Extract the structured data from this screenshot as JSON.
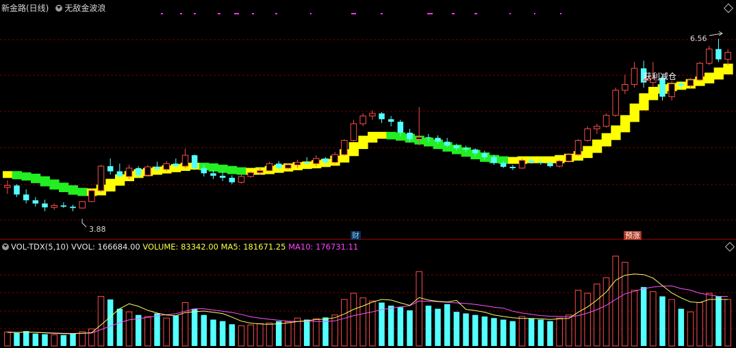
{
  "header": {
    "title": "新金路(日线)",
    "indicator": "无敌金波浪",
    "sell_signal": "获利减仓",
    "tag_cai": "财",
    "tag_yuzhang": "预涨",
    "high_label": "6.56",
    "low_label": "3.88"
  },
  "volume_header": {
    "name": "VOL-TDX(5,10)",
    "vvol": "VVOL: 166684.00",
    "volume": "VOLUME: 83342.00",
    "ma5": "MA5: 181671.25",
    "ma10": "MA10: 176731.11"
  },
  "colors": {
    "up": "#ff4d4d",
    "down": "#54ffff",
    "wave_up": "#ffff00",
    "wave_down": "#22ee22",
    "ma5": "#ffff66",
    "ma10": "#ff55ff",
    "grid": "#7a0000",
    "dots": "#ff33ff"
  },
  "chart_data": {
    "type": "candlestick",
    "ylim": [
      3.55,
      6.95
    ],
    "candles": [
      [
        4.25,
        4.36,
        4.15,
        4.28
      ],
      [
        4.28,
        4.3,
        4.1,
        4.14
      ],
      [
        4.14,
        4.22,
        4.0,
        4.05
      ],
      [
        4.05,
        4.1,
        3.95,
        4.0
      ],
      [
        4.0,
        4.06,
        3.88,
        3.94
      ],
      [
        3.94,
        4.0,
        3.9,
        3.97
      ],
      [
        3.97,
        4.02,
        3.93,
        3.95
      ],
      [
        3.95,
        3.98,
        3.88,
        3.93
      ],
      [
        3.93,
        4.04,
        3.92,
        4.03
      ],
      [
        4.03,
        4.22,
        4.02,
        4.2
      ],
      [
        4.2,
        4.6,
        4.18,
        4.58
      ],
      [
        4.58,
        4.7,
        4.45,
        4.5
      ],
      [
        4.5,
        4.62,
        4.4,
        4.42
      ],
      [
        4.42,
        4.6,
        4.38,
        4.55
      ],
      [
        4.55,
        4.58,
        4.4,
        4.44
      ],
      [
        4.44,
        4.6,
        4.42,
        4.57
      ],
      [
        4.57,
        4.65,
        4.5,
        4.53
      ],
      [
        4.53,
        4.66,
        4.5,
        4.62
      ],
      [
        4.62,
        4.7,
        4.55,
        4.58
      ],
      [
        4.58,
        4.85,
        4.55,
        4.75
      ],
      [
        4.75,
        4.76,
        4.52,
        4.55
      ],
      [
        4.55,
        4.6,
        4.42,
        4.47
      ],
      [
        4.47,
        4.52,
        4.38,
        4.43
      ],
      [
        4.43,
        4.5,
        4.35,
        4.4
      ],
      [
        4.4,
        4.44,
        4.3,
        4.33
      ],
      [
        4.33,
        4.45,
        4.31,
        4.42
      ],
      [
        4.42,
        4.5,
        4.4,
        4.48
      ],
      [
        4.48,
        4.55,
        4.45,
        4.51
      ],
      [
        4.51,
        4.65,
        4.5,
        4.62
      ],
      [
        4.62,
        4.66,
        4.52,
        4.55
      ],
      [
        4.55,
        4.63,
        4.53,
        4.6
      ],
      [
        4.6,
        4.68,
        4.55,
        4.64
      ],
      [
        4.64,
        4.72,
        4.6,
        4.62
      ],
      [
        4.62,
        4.75,
        4.58,
        4.7
      ],
      [
        4.7,
        4.72,
        4.6,
        4.64
      ],
      [
        4.64,
        4.8,
        4.62,
        4.76
      ],
      [
        4.76,
        5.0,
        4.74,
        4.98
      ],
      [
        4.98,
        5.3,
        4.96,
        5.24
      ],
      [
        5.24,
        5.4,
        5.2,
        5.36
      ],
      [
        5.36,
        5.45,
        5.3,
        5.4
      ],
      [
        5.4,
        5.42,
        5.25,
        5.31
      ],
      [
        5.31,
        5.36,
        5.2,
        5.27
      ],
      [
        5.27,
        5.3,
        5.05,
        5.1
      ],
      [
        5.1,
        5.16,
        4.95,
        5.0
      ],
      [
        5.0,
        5.5,
        4.9,
        5.03
      ],
      [
        5.03,
        5.08,
        4.96,
        5.02
      ],
      [
        5.02,
        5.06,
        4.92,
        4.96
      ],
      [
        4.96,
        5.02,
        4.88,
        4.9
      ],
      [
        4.9,
        4.93,
        4.82,
        4.86
      ],
      [
        4.86,
        4.9,
        4.8,
        4.84
      ],
      [
        4.84,
        4.86,
        4.74,
        4.78
      ],
      [
        4.78,
        4.82,
        4.68,
        4.72
      ],
      [
        4.72,
        4.76,
        4.6,
        4.63
      ],
      [
        4.63,
        4.66,
        4.55,
        4.57
      ],
      [
        4.57,
        4.6,
        4.52,
        4.55
      ],
      [
        4.55,
        4.7,
        4.54,
        4.67
      ],
      [
        4.67,
        4.72,
        4.62,
        4.64
      ],
      [
        4.64,
        4.7,
        4.6,
        4.63
      ],
      [
        4.63,
        4.66,
        4.56,
        4.58
      ],
      [
        4.58,
        4.68,
        4.56,
        4.66
      ],
      [
        4.66,
        4.78,
        4.64,
        4.76
      ],
      [
        4.76,
        5.0,
        4.74,
        4.98
      ],
      [
        4.98,
        5.2,
        4.96,
        5.16
      ],
      [
        5.16,
        5.24,
        5.08,
        5.2
      ],
      [
        5.2,
        5.4,
        5.18,
        5.37
      ],
      [
        5.37,
        5.8,
        5.35,
        5.76
      ],
      [
        5.76,
        6.0,
        5.7,
        5.85
      ],
      [
        5.85,
        6.2,
        5.8,
        6.1
      ],
      [
        6.1,
        6.22,
        5.8,
        5.88
      ],
      [
        5.88,
        6.2,
        5.82,
        5.95
      ],
      [
        5.95,
        6.0,
        5.6,
        5.66
      ],
      [
        5.66,
        5.9,
        5.6,
        5.86
      ],
      [
        5.86,
        5.9,
        5.78,
        5.83
      ],
      [
        5.83,
        5.95,
        5.8,
        5.92
      ],
      [
        5.92,
        6.2,
        5.9,
        6.18
      ],
      [
        6.18,
        6.45,
        6.15,
        6.4
      ],
      [
        6.4,
        6.56,
        6.2,
        6.24
      ],
      [
        6.24,
        6.4,
        6.15,
        6.35
      ]
    ],
    "wave": [
      4.45,
      4.43,
      4.41,
      4.37,
      4.32,
      4.27,
      4.23,
      4.19,
      4.17,
      4.18,
      4.24,
      4.33,
      4.4,
      4.45,
      4.48,
      4.5,
      4.52,
      4.54,
      4.56,
      4.58,
      4.58,
      4.57,
      4.55,
      4.53,
      4.51,
      4.5,
      4.5,
      4.51,
      4.53,
      4.55,
      4.57,
      4.59,
      4.6,
      4.62,
      4.64,
      4.69,
      4.79,
      4.9,
      5.0,
      5.06,
      5.06,
      5.05,
      5.03,
      5.0,
      4.97,
      4.94,
      4.9,
      4.86,
      4.82,
      4.78,
      4.74,
      4.7,
      4.68,
      4.67,
      4.67,
      4.68,
      4.68,
      4.68,
      4.68,
      4.7,
      4.72,
      4.76,
      4.84,
      4.94,
      5.04,
      5.16,
      5.32,
      5.5,
      5.66,
      5.76,
      5.8,
      5.82,
      5.84,
      5.88,
      5.92,
      5.98,
      6.06,
      6.12
    ],
    "volume_scale_max": 300000,
    "volumes": [
      45000,
      42000,
      48000,
      40000,
      38000,
      36000,
      35000,
      40000,
      46000,
      55000,
      160000,
      150000,
      120000,
      110000,
      100000,
      95000,
      105000,
      90000,
      98000,
      140000,
      120000,
      100000,
      85000,
      80000,
      70000,
      65000,
      68000,
      72000,
      74000,
      80000,
      78000,
      90000,
      85000,
      88000,
      92000,
      100000,
      150000,
      170000,
      155000,
      145000,
      140000,
      130000,
      125000,
      115000,
      240000,
      130000,
      120000,
      135000,
      110000,
      105000,
      100000,
      95000,
      90000,
      85000,
      80000,
      95000,
      88000,
      85000,
      80000,
      90000,
      100000,
      180000,
      170000,
      200000,
      220000,
      290000,
      270000,
      180000,
      190000,
      175000,
      160000,
      150000,
      120000,
      110000,
      140000,
      170000,
      160000,
      150000
    ],
    "ma5": [
      44000,
      43500,
      44500,
      43800,
      42600,
      40800,
      39400,
      39800,
      41000,
      42800,
      68000,
      94000,
      120000,
      136000,
      128000,
      115000,
      106000,
      100000,
      97600,
      107600,
      110600,
      112600,
      108600,
      104600,
      93000,
      80000,
      73600,
      71000,
      69800,
      71800,
      74400,
      78800,
      81400,
      85200,
      86600,
      91000,
      103000,
      118000,
      129000,
      141400,
      150000,
      148000,
      139000,
      131000,
      156000,
      148000,
      144000,
      142000,
      147000,
      118000,
      114000,
      109000,
      100000,
      95000,
      91000,
      89000,
      88600,
      87600,
      85600,
      87600,
      88600,
      109000,
      126000,
      148000,
      174000,
      212000,
      228000,
      232000,
      230000,
      219000,
      195000,
      171000,
      155000,
      142000,
      140000,
      150000,
      150000,
      150000
    ],
    "ma10": [
      45000,
      44000,
      44500,
      44000,
      43000,
      42000,
      41000,
      40500,
      41000,
      41500,
      53000,
      64000,
      75000,
      84000,
      88000,
      92000,
      97000,
      101000,
      104000,
      112000,
      120000,
      120000,
      116000,
      112000,
      108000,
      102000,
      94000,
      90000,
      86000,
      83000,
      80000,
      79000,
      80000,
      79000,
      79000,
      81000,
      89000,
      98000,
      104000,
      110000,
      117000,
      122000,
      126000,
      130000,
      145000,
      144000,
      143000,
      141000,
      139000,
      137000,
      134000,
      130000,
      125000,
      122000,
      112000,
      106000,
      102000,
      98000,
      96000,
      95000,
      94000,
      98000,
      106000,
      117000,
      131000,
      150000,
      168000,
      176000,
      185000,
      190000,
      193000,
      194000,
      185000,
      180000,
      170000,
      165000,
      160000,
      160000
    ]
  }
}
